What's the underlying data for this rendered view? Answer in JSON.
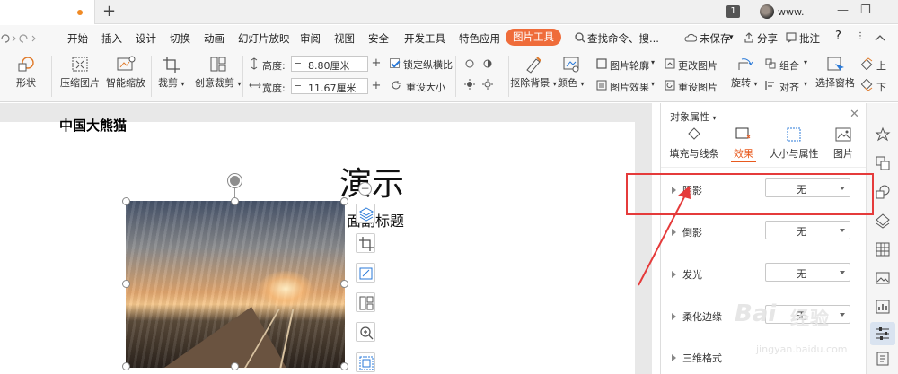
{
  "titlebar": {
    "new_tab": "+",
    "badge": "1",
    "user": "www.",
    "minimize": "—",
    "restore": "❐"
  },
  "menu": {
    "items": [
      "开始",
      "插入",
      "设计",
      "切换",
      "动画",
      "幻灯片放映",
      "审阅",
      "视图",
      "安全",
      "开发工具",
      "特色应用"
    ],
    "active_tab": "图片工具",
    "search": "查找命令、搜...",
    "unsaved": "未保存",
    "share": "分享",
    "comment": "批注",
    "help": "?"
  },
  "ribbon": {
    "shape": "形状",
    "compress": "压缩图片",
    "smart_scale": "智能缩放",
    "crop": "裁剪",
    "creative_crop": "创意裁剪",
    "height_label": "高度:",
    "height_value": "8.80厘米",
    "width_label": "宽度:",
    "width_value": "11.67厘米",
    "lock_ratio": "锁定纵横比",
    "reset_size": "重设大小",
    "remove_bg": "抠除背景",
    "color": "颜色",
    "pic_outline": "图片轮廓",
    "pic_effect": "图片效果",
    "change_pic": "更改图片",
    "reset_pic": "重设图片",
    "rotate": "旋转",
    "group": "组合",
    "align": "对齐",
    "selection_pane": "选择窗格",
    "up": "上",
    "down": "下"
  },
  "slide": {
    "left_text": "中国大熊猫",
    "title": "演示",
    "subtitle": "面副标题"
  },
  "panel": {
    "title": "对象属性",
    "tabs": [
      "填充与线条",
      "效果",
      "大小与属性",
      "图片"
    ],
    "active_tab_index": 1,
    "rows": [
      {
        "label": "阴影",
        "value": "无"
      },
      {
        "label": "倒影",
        "value": "无"
      },
      {
        "label": "发光",
        "value": "无"
      },
      {
        "label": "柔化边缘",
        "value": "无"
      },
      {
        "label": "三维格式",
        "value": ""
      }
    ]
  },
  "watermark": {
    "logo": "Bai",
    "text": "经验",
    "url": "jingyan.baidu.com"
  },
  "colors": {
    "accent": "#ef6c3a",
    "annotation": "#e53b3b"
  }
}
